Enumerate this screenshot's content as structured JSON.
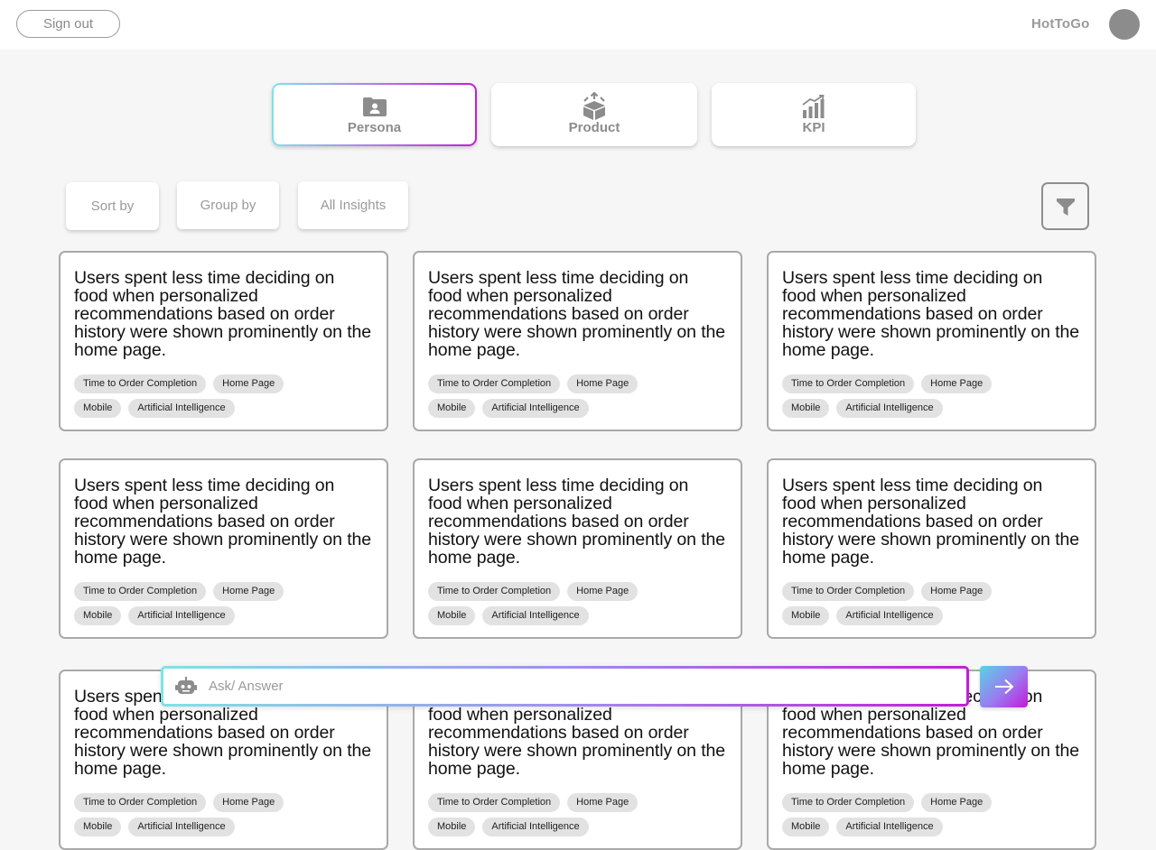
{
  "header": {
    "signout_label": "Sign out",
    "brand": "HotToGo"
  },
  "tabs": [
    {
      "label": "Persona",
      "icon": "persona-folder-icon",
      "active": true
    },
    {
      "label": "Product",
      "icon": "product-box-icon",
      "active": false
    },
    {
      "label": "KPI",
      "icon": "kpi-chart-icon",
      "active": false
    }
  ],
  "controls": {
    "sort_label": "Sort by",
    "group_label": "Group by",
    "insights_label": "All Insights",
    "filter_icon": "funnel-icon"
  },
  "cards": [
    {
      "text": "Users spent less time deciding on food when personalized recommendations based on order history were shown prominently on the home page.",
      "tags": [
        "Time to Order Completion",
        "Home Page",
        "Mobile",
        "Artificial Intelligence"
      ]
    },
    {
      "text": "Users spent less time deciding on food when personalized recommendations based on order history were shown prominently on the home page.",
      "tags": [
        "Time to Order Completion",
        "Home Page",
        "Mobile",
        "Artificial Intelligence"
      ]
    },
    {
      "text": "Users spent less time deciding on food when personalized recommendations based on order history were shown prominently on the home page.",
      "tags": [
        "Time to Order Completion",
        "Home Page",
        "Mobile",
        "Artificial Intelligence"
      ]
    },
    {
      "text": "Users spent less time deciding on food when personalized recommendations based on order history were shown prominently on the home page.",
      "tags": [
        "Time to Order Completion",
        "Home Page",
        "Mobile",
        "Artificial Intelligence"
      ]
    },
    {
      "text": "Users spent less time deciding on food when personalized recommendations based on order history were shown prominently on the home page.",
      "tags": [
        "Time to Order Completion",
        "Home Page",
        "Mobile",
        "Artificial Intelligence"
      ]
    },
    {
      "text": "Users spent less time deciding on food when personalized recommendations based on order history were shown prominently on the home page.",
      "tags": [
        "Time to Order Completion",
        "Home Page",
        "Mobile",
        "Artificial Intelligence"
      ]
    },
    {
      "text": "Users spent less time deciding on food when personalized recommendations based on order history were shown prominently on the home page.",
      "tags": [
        "Time to Order Completion",
        "Home Page",
        "Mobile",
        "Artificial Intelligence"
      ]
    },
    {
      "text": "Users spent less time deciding on food when personalized recommendations based on order history were shown prominently on the home page.",
      "tags": [
        "Time to Order Completion",
        "Home Page",
        "Mobile",
        "Artificial Intelligence"
      ]
    },
    {
      "text": "Users spent less time deciding on food when personalized recommendations based on order history were shown prominently on the home page.",
      "tags": [
        "Time to Order Completion",
        "Home Page",
        "Mobile",
        "Artificial Intelligence"
      ]
    }
  ],
  "chat": {
    "placeholder": "Ask/ Answer",
    "bot_icon": "robot-icon",
    "send_icon": "arrow-right-icon"
  },
  "colors": {
    "gradient_start": "#7fe3e6",
    "gradient_end": "#c21ed6",
    "muted_text": "#8c8c8c",
    "tag_bg": "#e2e2e2"
  }
}
